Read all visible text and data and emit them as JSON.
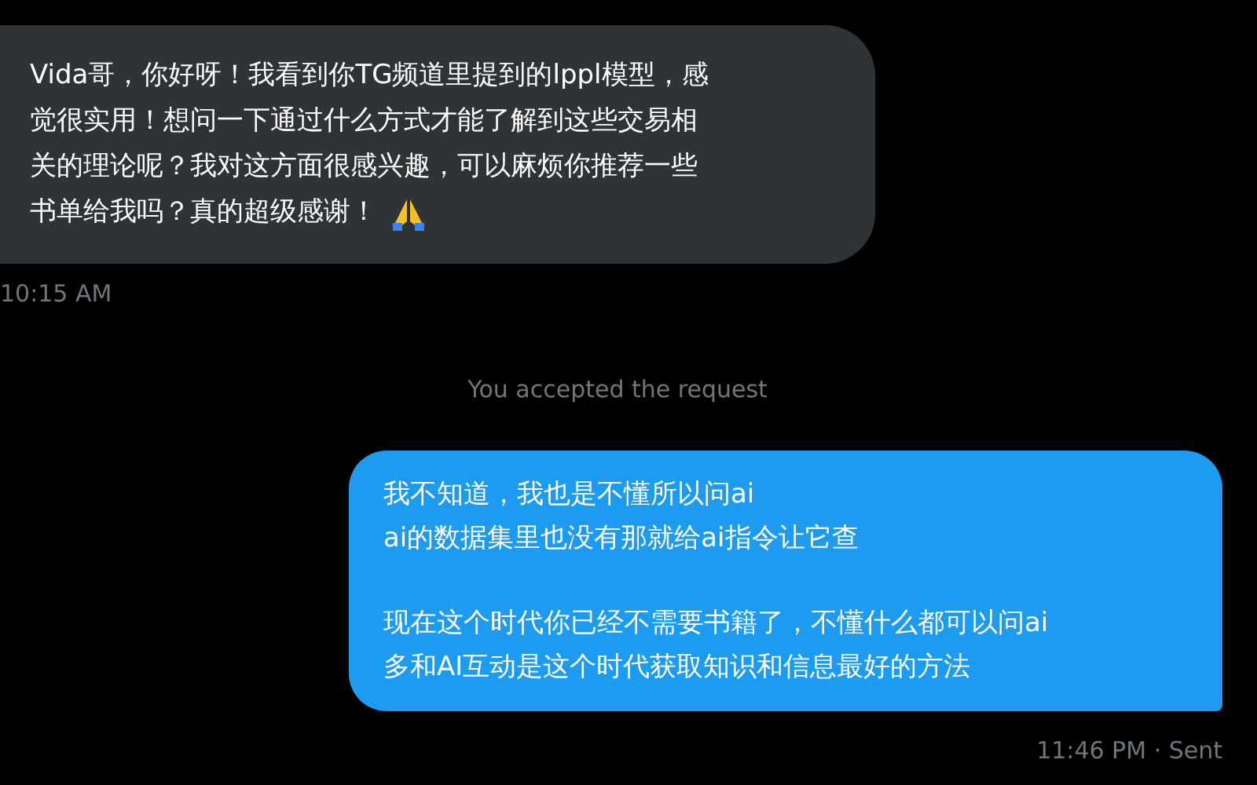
{
  "messages": [
    {
      "kind": "received",
      "lines": [
        "Vida哥，你好呀！我看到你TG频道里提到的lppl模型，感",
        "觉很实用！想问一下通过什么方式才能了解到这些交易相",
        "关的理论呢？我对这方面很感兴趣，可以麻烦你推荐一些",
        "书单给我吗？真的超级感谢！"
      ],
      "meta": "10:15 AM"
    },
    {
      "kind": "notice",
      "text": "You accepted the request"
    },
    {
      "kind": "sent",
      "paragraphs": [
        "我不知道，我也是不懂所以问ai\nai的数据集里也没有那就给ai指令让它查",
        "现在这个时代你已经不需要书籍了，不懂什么都可以问ai\n多和AI互动是这个时代获取知识和信息最好的方法"
      ],
      "meta": "11:46 PM · Sent"
    }
  ]
}
